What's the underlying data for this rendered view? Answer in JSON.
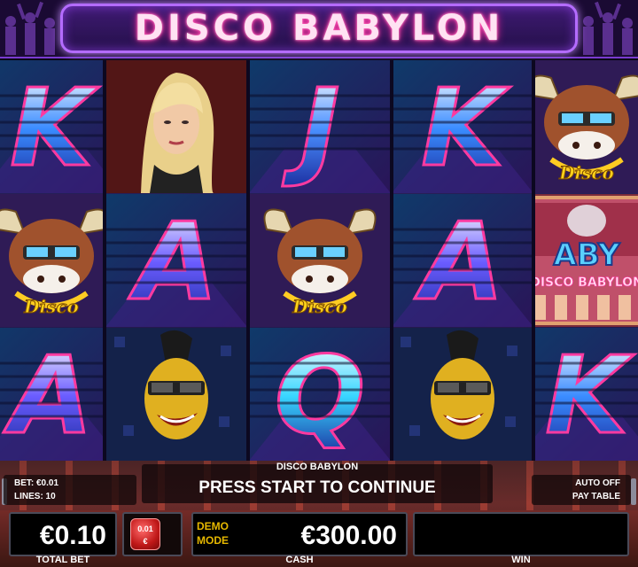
{
  "title": "DISCO BABYLON",
  "reels": [
    [
      "K",
      "bull",
      "A"
    ],
    [
      "blonde",
      "A",
      "mohawk"
    ],
    [
      "J",
      "bull",
      "Q"
    ],
    [
      "K",
      "A",
      "mohawk"
    ],
    [
      "bull",
      "babylon",
      "K"
    ]
  ],
  "symbol_labels": {
    "bull_badge": "Disco",
    "babylon_sign": "ABY",
    "babylon_sub": "DISCO BABYLON"
  },
  "console": {
    "game_name": "DISCO BABYLON",
    "message": "PRESS START TO CONTINUE",
    "bet_line": "BET: €0.01",
    "lines_line": "LINES: 10",
    "auto_label": "AUTO OFF",
    "paytable_label": "PAY TABLE",
    "total_bet_value": "€0.10",
    "total_bet_caption": "TOTAL BET",
    "coin_value": "0.01",
    "coin_unit": "€",
    "demo_mode_line1": "DEMO",
    "demo_mode_line2": "MODE",
    "cash_value": "€300.00",
    "cash_caption": "CASH",
    "win_value": "",
    "win_caption": "WIN"
  },
  "colors": {
    "title_glow": "#ff2d9c",
    "demo_text": "#e6b800",
    "coin_red": "#c01818"
  }
}
